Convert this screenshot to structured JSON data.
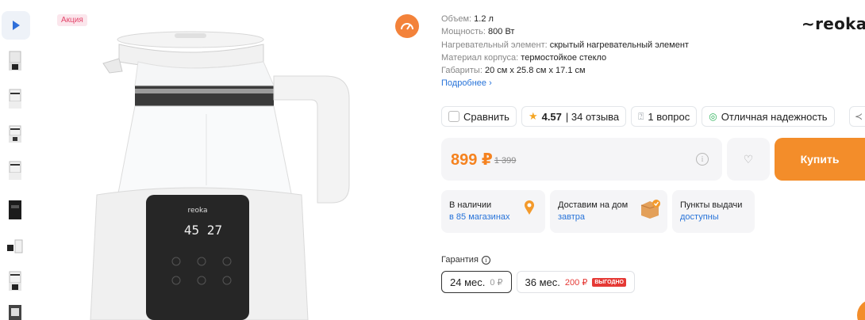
{
  "promo": {
    "label": "Акция"
  },
  "specs": [
    {
      "label": "Объем:",
      "value": "1.2 л"
    },
    {
      "label": "Мощность:",
      "value": "800 Вт"
    },
    {
      "label": "Нагревательный элемент:",
      "value": "скрытый нагревательный элемент"
    },
    {
      "label": "Материал корпуса:",
      "value": "термостойкое стекло"
    },
    {
      "label": "Габариты:",
      "value": "20 см x 25.8 см x 17.1 см"
    }
  ],
  "more_link": "Подробнее",
  "brand": {
    "name": "reoka"
  },
  "kettle_display": {
    "brand": "reoka",
    "readout": "45 27"
  },
  "chips": {
    "compare": "Сравнить",
    "rating": "4.57",
    "reviews": "| 34 отзыва",
    "questions": "1 вопрос",
    "reliability": "Отличная надежность"
  },
  "price": {
    "current": "899 ₽",
    "old": "1 399"
  },
  "buy_button": "Купить",
  "availability": [
    {
      "title": "В наличии",
      "link": "в 85 магазинах"
    },
    {
      "title": "Доставим на дом",
      "link": "завтра"
    },
    {
      "title": "Пункты выдачи",
      "link": "доступны"
    }
  ],
  "warranty": {
    "label": "Гарантия",
    "options": [
      {
        "term": "24 мес.",
        "price": "0 ₽",
        "badge": ""
      },
      {
        "term": "36 мес.",
        "price": "200 ₽",
        "badge": "ВЫГОДНО"
      }
    ]
  },
  "colors": {
    "accent": "#f38d2a",
    "price": "#f5821f",
    "link": "#2773d9",
    "badge_red": "#e53935"
  }
}
